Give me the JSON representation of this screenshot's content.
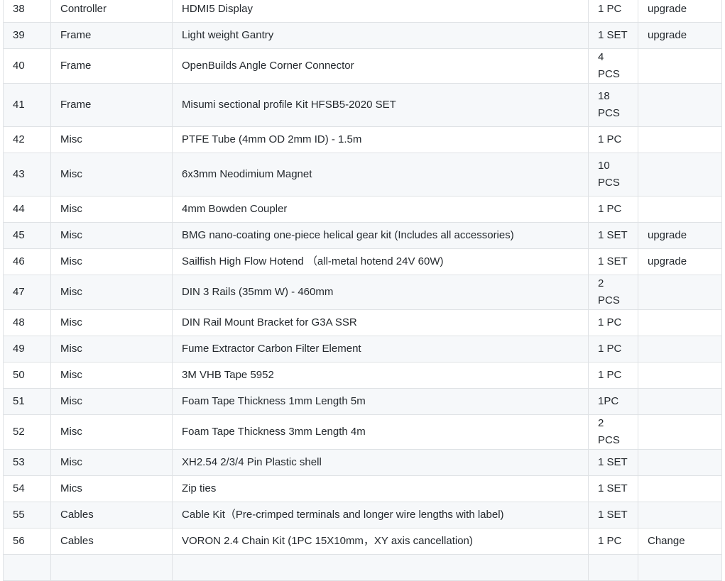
{
  "rows": [
    {
      "no": "38",
      "category": "Controller",
      "item": "HDMI5 Display",
      "qty": "1 PC",
      "note": "upgrade"
    },
    {
      "no": "39",
      "category": "Frame",
      "item": "Light weight Gantry",
      "qty": "1 SET",
      "note": "upgrade"
    },
    {
      "no": "40",
      "category": "Frame",
      "item": "OpenBuilds Angle Corner Connector",
      "qty": "4 PCS",
      "note": ""
    },
    {
      "no": "41",
      "category": "Frame",
      "item": "Misumi sectional profile Kit HFSB5-2020 SET",
      "qty": "18 PCS",
      "note": ""
    },
    {
      "no": "42",
      "category": "Misc",
      "item": "PTFE Tube (4mm OD 2mm ID) - 1.5m",
      "qty": "1 PC",
      "note": ""
    },
    {
      "no": "43",
      "category": "Misc",
      "item": "6x3mm Neodimium Magnet",
      "qty": "10 PCS",
      "note": ""
    },
    {
      "no": "44",
      "category": "Misc",
      "item": "4mm Bowden Coupler",
      "qty": "1 PC",
      "note": ""
    },
    {
      "no": "45",
      "category": "Misc",
      "item": "BMG nano-coating one-piece helical gear kit (Includes all accessories)",
      "qty": "1 SET",
      "note": "upgrade"
    },
    {
      "no": "46",
      "category": "Misc",
      "item": "Sailfish High Flow Hotend （all-metal hotend 24V 60W)",
      "qty": "1 SET",
      "note": "upgrade"
    },
    {
      "no": "47",
      "category": "Misc",
      "item": "DIN 3 Rails (35mm W) - 460mm",
      "qty": "2 PCS",
      "note": ""
    },
    {
      "no": "48",
      "category": "Misc",
      "item": "DIN Rail Mount Bracket for G3A SSR",
      "qty": "1 PC",
      "note": ""
    },
    {
      "no": "49",
      "category": "Misc",
      "item": "Fume Extractor Carbon Filter Element",
      "qty": "1 PC",
      "note": ""
    },
    {
      "no": "50",
      "category": "Misc",
      "item": "3M VHB Tape 5952",
      "qty": "1 PC",
      "note": ""
    },
    {
      "no": "51",
      "category": "Misc",
      "item": "Foam Tape Thickness 1mm Length 5m",
      "qty": "1PC",
      "note": ""
    },
    {
      "no": "52",
      "category": "Misc",
      "item": "Foam Tape Thickness 3mm Length 4m",
      "qty": "2 PCS",
      "note": ""
    },
    {
      "no": "53",
      "category": "Misc",
      "item": "XH2.54 2/3/4 Pin Plastic shell",
      "qty": "1 SET",
      "note": ""
    },
    {
      "no": "54",
      "category": "Mics",
      "item": "Zip ties",
      "qty": "1 SET",
      "note": ""
    },
    {
      "no": "55",
      "category": "Cables",
      "item": "Cable Kit（Pre-crimped terminals and longer wire lengths with label)",
      "qty": "1 SET",
      "note": ""
    },
    {
      "no": "56",
      "category": "Cables",
      "item": "VORON 2.4 Chain Kit (1PC 15X10mm，XY axis cancellation)",
      "qty": "1 PC",
      "note": "Change"
    }
  ]
}
